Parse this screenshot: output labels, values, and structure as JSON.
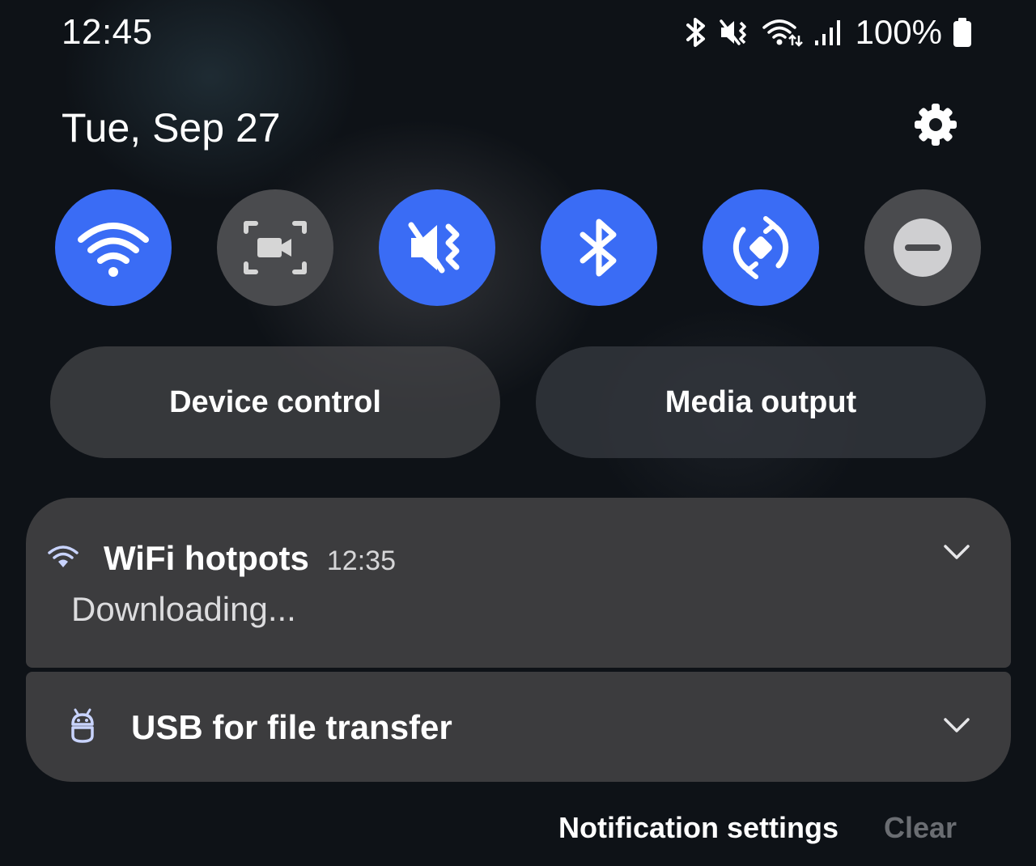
{
  "status_bar": {
    "time": "12:45",
    "battery": "100%",
    "icons": [
      "bluetooth-icon",
      "vibrate-mute-icon",
      "wifi-data-icon",
      "signal-icon",
      "battery-icon"
    ]
  },
  "header": {
    "date": "Tue, Sep 27",
    "settings_icon": "gear-icon"
  },
  "quick_settings": [
    {
      "name": "wifi",
      "icon": "wifi-icon",
      "state": "on"
    },
    {
      "name": "screen-recorder",
      "icon": "screen-record-icon",
      "state": "off"
    },
    {
      "name": "mute",
      "icon": "vibrate-mute-icon",
      "state": "on"
    },
    {
      "name": "bluetooth",
      "icon": "bluetooth-icon",
      "state": "on"
    },
    {
      "name": "auto-rotate",
      "icon": "rotate-icon",
      "state": "on"
    },
    {
      "name": "do-not-disturb",
      "icon": "minus-circle-icon",
      "state": "off"
    }
  ],
  "actions": {
    "device_control": "Device control",
    "media_output": "Media output"
  },
  "notifications": [
    {
      "icon": "wifi-icon",
      "title": "WiFi hotpots",
      "time": "12:35",
      "body": "Downloading..."
    },
    {
      "icon": "android-usb-icon",
      "title": "USB for file transfer"
    }
  ],
  "footer": {
    "notification_settings": "Notification settings",
    "clear": "Clear"
  },
  "colors": {
    "accent": "#3a6cf5",
    "tile_off": "#4a4b4e",
    "card": "#3c3c3e",
    "clear_disabled": "#6a6d72",
    "notif_icon": "#c9d4ff"
  }
}
